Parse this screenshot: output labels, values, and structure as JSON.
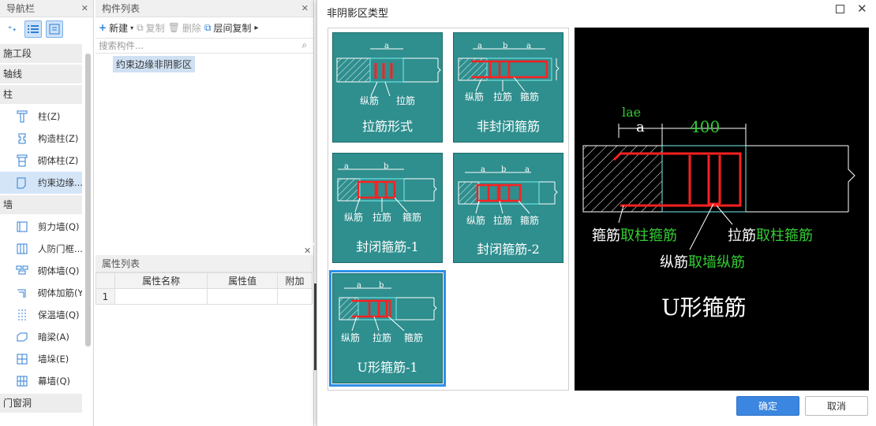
{
  "nav": {
    "title": "导航栏",
    "groups": [
      "施工段",
      "轴线",
      "柱",
      "墙",
      "门窗洞"
    ],
    "col_items": [
      "柱(Z)",
      "构造柱(Z)",
      "砌体柱(Z)",
      "约束边缘..."
    ],
    "wall_items": [
      "剪力墙(Q)",
      "人防门框...",
      "砌体墙(Q)",
      "砌体加筋(Y",
      "保温墙(Q)",
      "暗梁(A)",
      "墙垛(E)",
      "幕墙(Q)"
    ]
  },
  "comp": {
    "title": "构件列表",
    "new_label": "新建",
    "copy_label": "复制",
    "delete_label": "删除",
    "floor_copy_label": "层间复制",
    "search_placeholder": "搜索构件...",
    "item": "约束边缘非阴影区"
  },
  "prop": {
    "title": "属性列表",
    "headers": [
      "属性名称",
      "属性值",
      "附加"
    ],
    "row1": "1"
  },
  "dialog": {
    "title": "非阴影区类型",
    "options": [
      "拉筋形式",
      "非封闭箍筋",
      "封闭箍筋-1",
      "封闭箍筋-2",
      "U形箍筋-1"
    ],
    "selected": "U形箍筋-1",
    "thumb_labels": {
      "zong": "纵筋",
      "la": "拉筋",
      "gu": "箍筋",
      "a": "a",
      "b": "b"
    },
    "preview": {
      "lae": "lae",
      "a": "a",
      "dim": "400",
      "gu_prefix": "箍筋",
      "gu_suffix": "取柱箍筋",
      "la_prefix": "拉筋",
      "la_suffix": "取柱箍筋",
      "zong_prefix": "纵筋",
      "zong_suffix": "取墙纵筋",
      "name": "U形箍筋"
    },
    "ok": "确定",
    "cancel": "取消"
  },
  "colors": {
    "teal": "#2f8e8e",
    "accent": "#3a86e0",
    "rebar": "#ff2020",
    "green": "#33cc33"
  }
}
